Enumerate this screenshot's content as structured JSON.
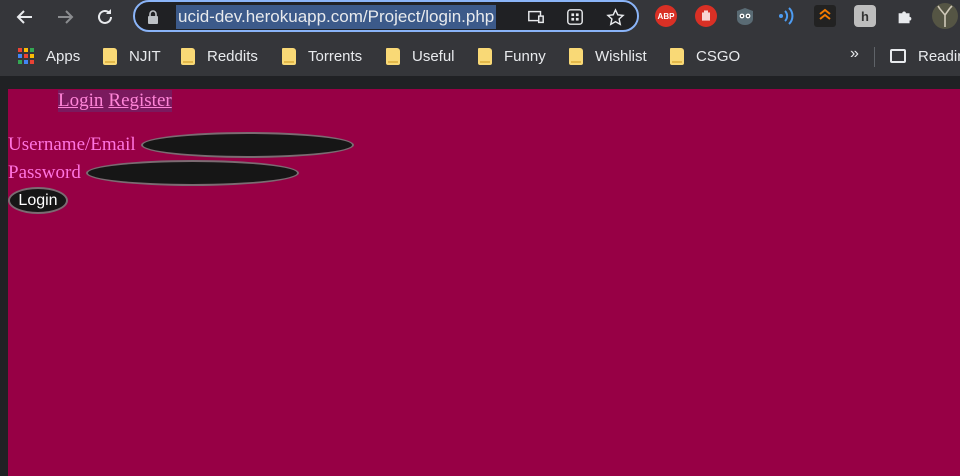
{
  "browser": {
    "url": "ucid-dev.herokuapp.com/Project/login.php",
    "extensions": [
      "abp-icon",
      "stop-hand-icon",
      "owl-mask-icon",
      "radio-waves-icon",
      "fox-icon",
      "h-icon",
      "puzzle-icon",
      "profile-avatar"
    ],
    "abp_label": "ABP",
    "h_label": "h"
  },
  "bookmarks": {
    "items": [
      {
        "label": "Apps"
      },
      {
        "label": "NJIT"
      },
      {
        "label": "Reddits"
      },
      {
        "label": "Torrents"
      },
      {
        "label": "Useful"
      },
      {
        "label": "Funny"
      },
      {
        "label": "Wishlist"
      },
      {
        "label": "CSGO"
      }
    ],
    "more": "»",
    "reading_list": "Readin"
  },
  "page": {
    "nav": {
      "login": "Login",
      "register": "Register"
    },
    "form": {
      "username_label": "Username/Email",
      "username_value": "",
      "password_label": "Password",
      "password_value": "",
      "submit": "Login"
    },
    "colors": {
      "background": "#970045",
      "label": "#ff73e0",
      "link": "#ff85d8",
      "input": "#161616"
    }
  }
}
